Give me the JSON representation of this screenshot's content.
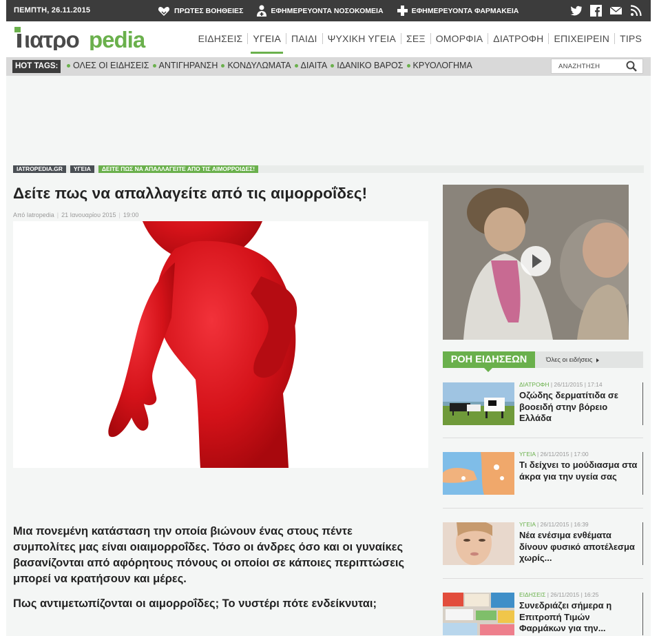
{
  "topbar": {
    "date": "ΠΕΜΠΤΗ, 26.11.2015",
    "links": [
      {
        "label": "ΠΡΩΤΕΣ ΒΟΗΘΕΙΕΣ",
        "icon": "heart-hands-icon"
      },
      {
        "label": "ΕΦΗΜΕΡΕΥΟΝΤΑ ΝΟΣΟΚΟΜΕΙΑ",
        "icon": "doctor-icon"
      },
      {
        "label": "ΕΦΗΜΕΡΕΥΟΝΤΑ ΦΑΡΜΑΚΕΙΑ",
        "icon": "pharmacy-cross-icon"
      }
    ],
    "social": [
      "twitter-icon",
      "facebook-icon",
      "mail-icon",
      "rss-icon"
    ]
  },
  "logo": {
    "text_a": "ιατρο",
    "text_b": "pedia"
  },
  "nav": {
    "items": [
      "ΕΙΔΗΣΕΙΣ",
      "ΥΓΕΙΑ",
      "ΠΑΙΔΙ",
      "ΨΥΧΙΚΗ ΥΓΕΙΑ",
      "ΣΕΞ",
      "ΟΜΟΡΦΙΑ",
      "ΔΙΑΤΡΟΦΗ",
      "ΕΠΙΧΕΙΡΕΙΝ",
      "TIPS"
    ],
    "active_index": 1
  },
  "tags": {
    "label": "HOT TAGS:",
    "items": [
      "ΟΛΕΣ ΟΙ ΕΙΔΗΣΕΙΣ",
      "ΑΝΤΙΓΗΡΑΝΣΗ",
      "ΚΟΝΔΥΛΩΜΑΤΑ",
      "ΔΙΑΙΤΑ",
      "ΙΔΑΝΙΚΟ ΒΑΡΟΣ",
      "ΚΡΥΟΛΟΓΗΜΑ"
    ]
  },
  "search": {
    "placeholder": "ΑΝΑΖΗΤΗΣΗ"
  },
  "breadcrumbs": [
    "IATROPEDIA.GR",
    "ΥΓΕΙΑ",
    "ΔΕΙΤΕ ΠΩΣ ΝΑ ΑΠΑΛΛΑΓΕΙΤΕ ΑΠΟ ΤΙΣ ΑΙΜΟΡΡΟΙΔΕΣ!"
  ],
  "article": {
    "title": "Δείτε πως να απαλλαγείτε από τις αιμορροΐδες!",
    "author": "Από Iatropedia",
    "date": "21 Ιανουαρίου 2015",
    "time": "19:00",
    "lead": "Μια πονεμένη κατάσταση την οποία βιώνουν ένας στους πέντε συμπολίτες μας είναι οιαιμορροΐδες. Τόσο οι άνδρες όσο και οι γυναίκες βασανίζονται από αφόρητους πόνους οι οποίοι σε κάποιες περιπτώσεις μπορεί να κρατήσουν και μέρες.",
    "subheading": "Πως αντιμετωπίζονται οι αιμορροΐδες; Το νυστέρι πότε ενδείκνυται;"
  },
  "newsfeed": {
    "title": "ΡΟΗ ΕΙΔΗΣΕΩΝ",
    "all_label": "Όλες οι ειδήσεις",
    "items": [
      {
        "category": "ΔΙΑΤΡΟΦΗ",
        "date": "26/11/2015",
        "time": "17:14",
        "title": "Οζώδης δερματίτιδα σε βοοειδή στην βόρειο Ελλάδα"
      },
      {
        "category": "ΥΓΕΙΑ",
        "date": "26/11/2015",
        "time": "17:00",
        "title": "Τι δείχνει το μούδιασμα στα άκρα για την υγεία σας"
      },
      {
        "category": "ΥΓΕΙΑ",
        "date": "26/11/2015",
        "time": "16:39",
        "title": "Νέα ενέσιμα ενθέματα δίνουν φυσικό αποτέλεσμα χωρίς..."
      },
      {
        "category": "ΕΙΔΗΣΕΙΣ",
        "date": "26/11/2015",
        "time": "16:25",
        "title": "Συνεδριάζει σήμερα η Επιτροπή Τιμών Φαρμάκων για την..."
      }
    ]
  },
  "colors": {
    "accent": "#6ab04c",
    "dark": "#3c3c3c",
    "bg": "#f4f6f5"
  }
}
